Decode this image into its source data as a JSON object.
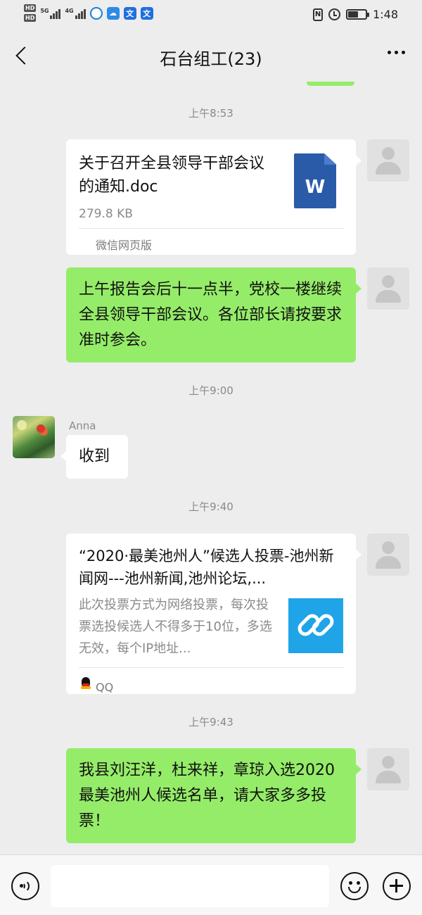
{
  "status_bar": {
    "time": "1:48",
    "net_1": "5G",
    "net_2": "4G",
    "hd_1": "HD",
    "hd_2": "HD",
    "battery_level": 0.6
  },
  "header": {
    "title": "石台组工(23)"
  },
  "messages": [
    {
      "timestamp": "上午8:53",
      "type": "file",
      "direction": "outgoing",
      "file_name": "关于召开全县领导干部会议的通知.doc",
      "file_size": "279.8 KB",
      "file_icon": "word-doc-icon",
      "file_icon_letter": "W",
      "source": "微信网页版"
    },
    {
      "type": "text",
      "direction": "outgoing",
      "text": "上午报告会后十一点半，党校一楼继续全县领导干部会议。各位部长请按要求准时参会。"
    },
    {
      "timestamp": "上午9:00",
      "type": "text",
      "direction": "incoming",
      "sender": "Anna",
      "text": "收到"
    },
    {
      "timestamp": "上午9:40",
      "type": "link",
      "direction": "outgoing",
      "title": "“2020·最美池州人”候选人投票-池州新闻网---池州新闻,池州论坛,...",
      "description": "此次投票方式为网络投票，每次投票选投候选人不得多于10位，多选无效，每个IP地址...",
      "thumb_icon": "link-icon",
      "source": "QQ"
    },
    {
      "timestamp": "上午9:43",
      "type": "text",
      "direction": "outgoing",
      "text": "我县刘汪洋，杜来祥，章琼入选2020 最美池州人候选名单，请大家多多投票！"
    }
  ],
  "input_bar": {
    "placeholder": ""
  },
  "colors": {
    "background": "#ededed",
    "outgoing_bubble": "#95ec69",
    "incoming_bubble": "#ffffff",
    "word_blue": "#2a5ba9",
    "link_thumb": "#1fa4e8"
  }
}
